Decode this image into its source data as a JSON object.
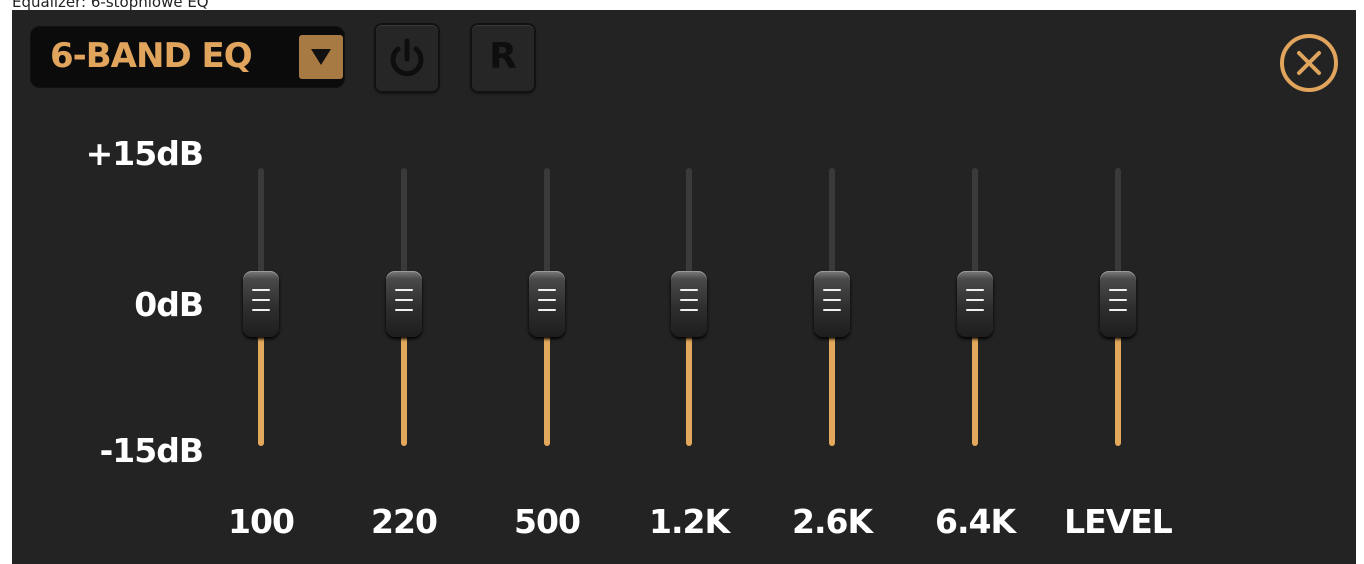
{
  "caption": "Equalizer: 6-stopniowe EQ",
  "header": {
    "preset_label": "6-BAND EQ",
    "power_button": "power-icon",
    "reset_label": "R",
    "close_button": "close-icon"
  },
  "scale": {
    "top": "+15dB",
    "mid": "0dB",
    "bottom": "-15dB"
  },
  "bands": [
    {
      "label": "100",
      "gain_db": 0
    },
    {
      "label": "220",
      "gain_db": 0
    },
    {
      "label": "500",
      "gain_db": 0
    },
    {
      "label": "1.2K",
      "gain_db": 0
    },
    {
      "label": "2.6K",
      "gain_db": 0
    },
    {
      "label": "6.4K",
      "gain_db": 0
    },
    {
      "label": "LEVEL",
      "gain_db": 0
    }
  ],
  "colors": {
    "panel_bg": "#232323",
    "accent": "#e0a45d",
    "track_active": "#e2a95c",
    "track_inactive": "#3a3a3a"
  }
}
